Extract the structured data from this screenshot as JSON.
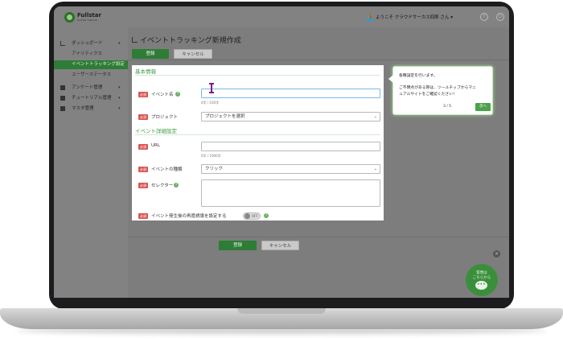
{
  "header": {
    "logo_text": "Fullstar",
    "logo_sub": "CLOUD CIRCUS",
    "welcome": "ようこそ クラウドサーカス四郎 さん ▾",
    "help_glyph": "?",
    "power_glyph": "⏻"
  },
  "sidebar": {
    "dashboard": "ダッシュボード",
    "analytics": "アナリティクス",
    "event_tracking": "イベントトラッキング設定",
    "user_status": "ユーザーステータス",
    "anchor": "アンケート管理",
    "tutorial": "チュートリアル管理",
    "master": "マスタ管理",
    "chevron": "▾"
  },
  "page": {
    "title": "イベントトラッキング新規作成",
    "register_label": "登録",
    "cancel_label": "キャンセル"
  },
  "form": {
    "section_basic": "基本情報",
    "section_detail": "イベント詳細設定",
    "required": "必須",
    "event_name_label": "イベント名",
    "event_name_value": "",
    "event_name_counter": "0字 / 100字",
    "project_label": "プロジェクト",
    "project_value": "プロジェクトを選択",
    "url_label": "URL",
    "url_value": "",
    "url_counter": "0字 / 1000字",
    "event_type_label": "イベントの種類",
    "event_type_value": "クリック",
    "selector_label": "セレクター",
    "selector_value": "",
    "event_limit_label": "イベント発生後の再度誘導を設定する",
    "toggle_label": "OFF"
  },
  "tooltip": {
    "line1": "各種設定を行います。",
    "line2": "ご不明点がある際は、ツールチップからマニ",
    "line3": "ュアルサイトをご確認ください！",
    "page": "3 / 5",
    "next_label": "次へ"
  },
  "chat": {
    "line1": "質問は",
    "line2": "こちらから"
  }
}
